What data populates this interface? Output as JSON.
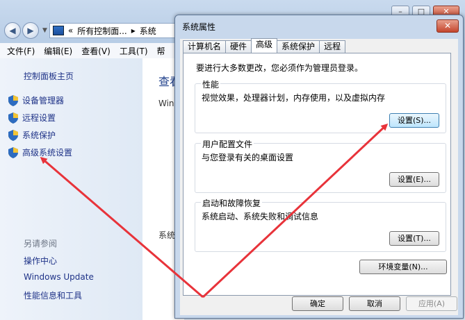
{
  "explorer": {
    "breadcrumb_prefix": "«",
    "breadcrumb_root": "所有控制面...",
    "breadcrumb_sep": "▸",
    "breadcrumb_current": "系统",
    "menu": [
      "文件(F)",
      "编辑(E)",
      "查看(V)",
      "工具(T)",
      "帮"
    ],
    "sidebar": {
      "home_link": "控制面板主页",
      "items": [
        "设备管理器",
        "远程设置",
        "系统保护",
        "高级系统设置"
      ],
      "see_also_title": "另请参阅",
      "see_also": [
        "操作中心",
        "Windows Update",
        "性能信息和工具"
      ]
    },
    "main": {
      "heading": "查看",
      "line1": "Win",
      "line2": "系统"
    }
  },
  "dialog": {
    "title": "系统属性",
    "close_label": "✕",
    "tabs": [
      "计算机名",
      "硬件",
      "高级",
      "系统保护",
      "远程"
    ],
    "active_tab": "高级",
    "intro": "要进行大多数更改，您必须作为管理员登录。",
    "groups": [
      {
        "title": "性能",
        "desc": "视觉效果，处理器计划，内存使用，以及虚拟内存",
        "button": "设置(S)..."
      },
      {
        "title": "用户配置文件",
        "desc": "与您登录有关的桌面设置",
        "button": "设置(E)..."
      },
      {
        "title": "启动和故障恢复",
        "desc": "系统启动、系统失败和调试信息",
        "button": "设置(T)..."
      }
    ],
    "env_button": "环境变量(N)...",
    "ok": "确定",
    "cancel": "取消",
    "apply": "应用(A)"
  },
  "colors": {
    "arrow": "#e8333a",
    "link": "#1e3287"
  }
}
